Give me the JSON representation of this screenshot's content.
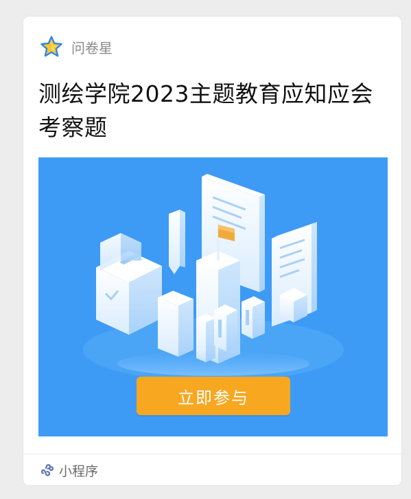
{
  "source": {
    "name": "问卷星",
    "icon": "star-icon",
    "icon_colors": {
      "fill": "#f9c534",
      "outline": "#2f88e6"
    }
  },
  "title": "测绘学院2023主题教育应知应会考察题",
  "cover": {
    "background": "#3d9bf5",
    "join_button_label": "立即参与",
    "join_button_color": "#f7a720"
  },
  "footer": {
    "label": "小程序",
    "icon": "mini-program-icon"
  }
}
